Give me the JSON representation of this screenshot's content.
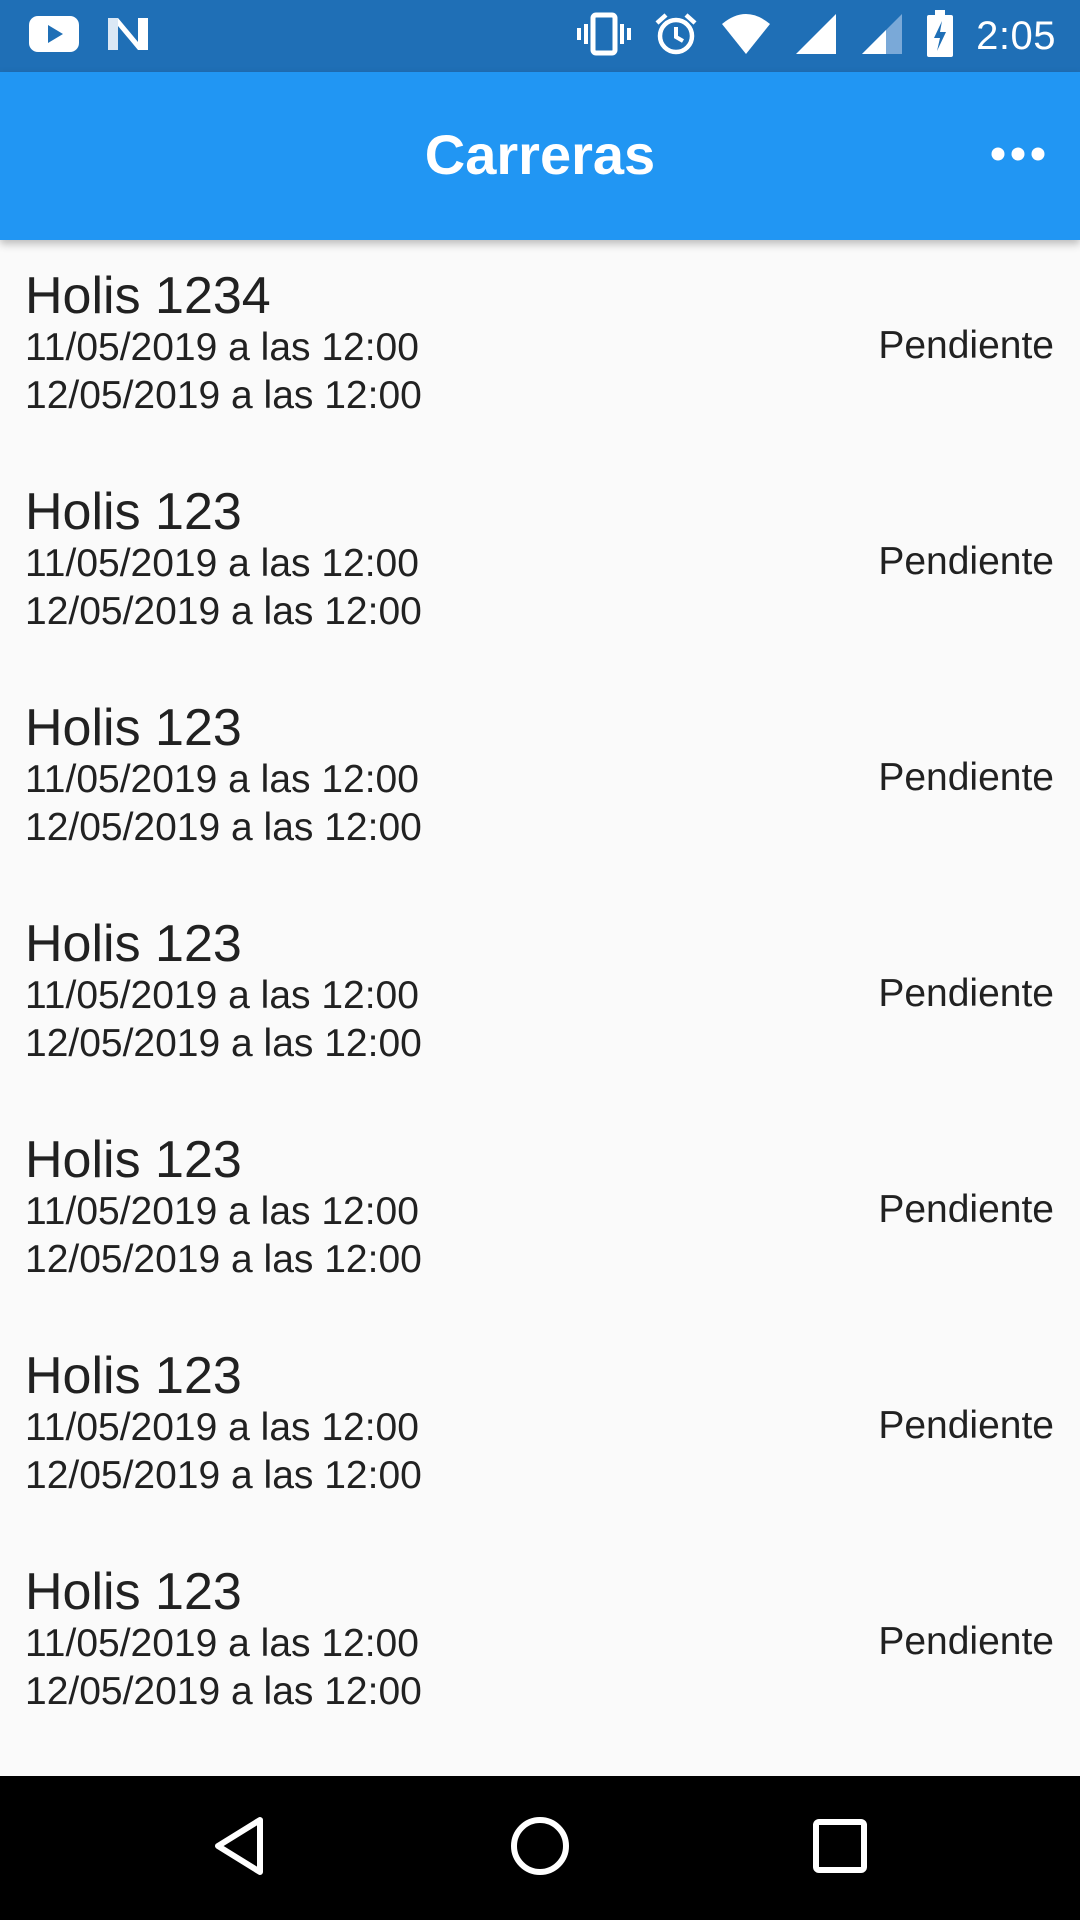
{
  "status_bar": {
    "time": "2:05",
    "left_icons": [
      "youtube-icon",
      "n-app-icon"
    ],
    "right_icons": [
      "vibrate-icon",
      "alarm-icon",
      "wifi-icon",
      "signal-icon",
      "signal-2-icon",
      "battery-charging-icon"
    ]
  },
  "app_bar": {
    "title": "Carreras",
    "more_icon": "more-horizontal-icon"
  },
  "races": [
    {
      "name": "Holis 1234",
      "start": "11/05/2019 a las 12:00",
      "end": "12/05/2019 a las 12:00",
      "status": "Pendiente"
    },
    {
      "name": "Holis 123",
      "start": "11/05/2019 a las 12:00",
      "end": "12/05/2019 a las 12:00",
      "status": "Pendiente"
    },
    {
      "name": "Holis 123",
      "start": "11/05/2019 a las 12:00",
      "end": "12/05/2019 a las 12:00",
      "status": "Pendiente"
    },
    {
      "name": "Holis 123",
      "start": "11/05/2019 a las 12:00",
      "end": "12/05/2019 a las 12:00",
      "status": "Pendiente"
    },
    {
      "name": "Holis 123",
      "start": "11/05/2019 a las 12:00",
      "end": "12/05/2019 a las 12:00",
      "status": "Pendiente"
    },
    {
      "name": "Holis 123",
      "start": "11/05/2019 a las 12:00",
      "end": "12/05/2019 a las 12:00",
      "status": "Pendiente"
    },
    {
      "name": "Holis 123",
      "start": "11/05/2019 a las 12:00",
      "end": "12/05/2019 a las 12:00",
      "status": "Pendiente"
    }
  ],
  "nav_bar": {
    "icons": [
      "back-icon",
      "home-icon",
      "recents-icon"
    ]
  },
  "colors": {
    "status_bar": "#1f6fb6",
    "app_bar": "#2196f3",
    "background": "#fafafa",
    "text": "#212121"
  }
}
